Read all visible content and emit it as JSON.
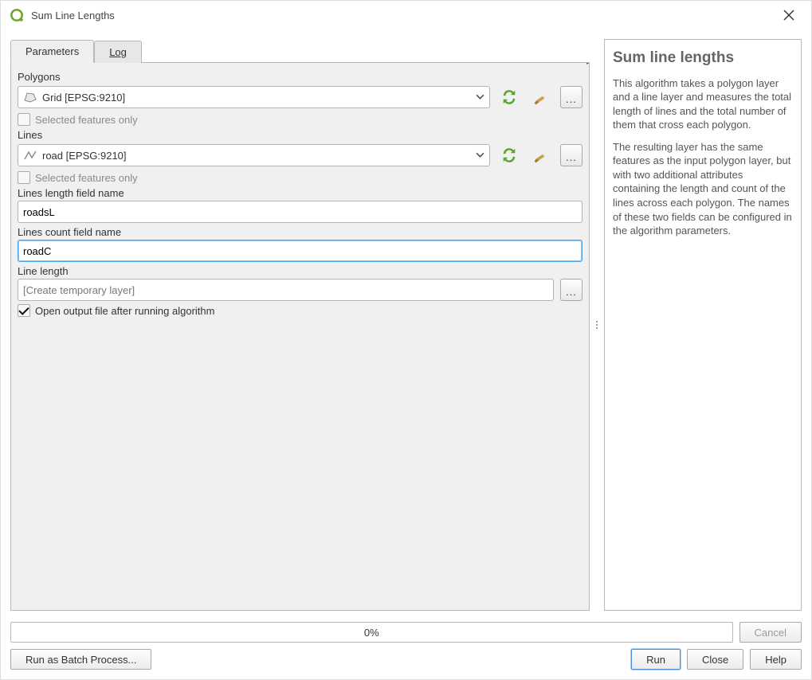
{
  "window": {
    "title": "Sum Line Lengths"
  },
  "tabs": {
    "parameters": "Parameters",
    "log": "Log"
  },
  "polygons": {
    "label": "Polygons",
    "value": "Grid [EPSG:9210]",
    "selected_only": "Selected features only"
  },
  "lines": {
    "label": "Lines",
    "value": "road [EPSG:9210]",
    "selected_only": "Selected features only"
  },
  "length_field": {
    "label": "Lines length field name",
    "value": "roadsL"
  },
  "count_field": {
    "label": "Lines count field name",
    "value": "roadC"
  },
  "output": {
    "label": "Line length",
    "placeholder": "[Create temporary layer]",
    "open_after": "Open output file after running algorithm"
  },
  "help": {
    "title": "Sum line lengths",
    "p1": "This algorithm takes a polygon layer and a line layer and measures the total length of lines and the total number of them that cross each polygon.",
    "p2": "The resulting layer has the same features as the input polygon layer, but with two additional attributes containing the length and count of the lines across each polygon. The names of these two fields can be configured in the algorithm parameters."
  },
  "progress": {
    "text": "0%"
  },
  "buttons": {
    "cancel": "Cancel",
    "batch": "Run as Batch Process...",
    "run": "Run",
    "close": "Close",
    "help_btn": "Help",
    "dots": "..."
  }
}
